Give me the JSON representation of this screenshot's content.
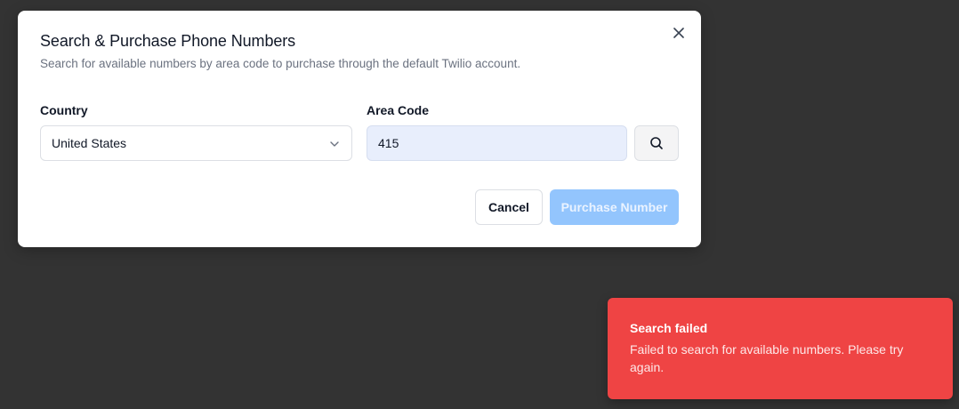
{
  "dialog": {
    "title": "Search & Purchase Phone Numbers",
    "description": "Search for available numbers by area code to purchase through the default Twilio account.",
    "close_icon": "close-icon"
  },
  "form": {
    "country_label": "Country",
    "country_value": "United States",
    "area_code_label": "Area Code",
    "area_code_value": "415",
    "search_icon": "search-icon"
  },
  "actions": {
    "cancel_label": "Cancel",
    "purchase_label": "Purchase Number",
    "purchase_disabled": true
  },
  "toast": {
    "title": "Search failed",
    "message": "Failed to search for available numbers. Please try again.",
    "variant": "destructive"
  },
  "colors": {
    "backdrop": "#333333",
    "toast_bg": "#ef4444",
    "purchase_disabled_bg": "#93c5fd",
    "area_input_bg": "#e8eefc"
  }
}
